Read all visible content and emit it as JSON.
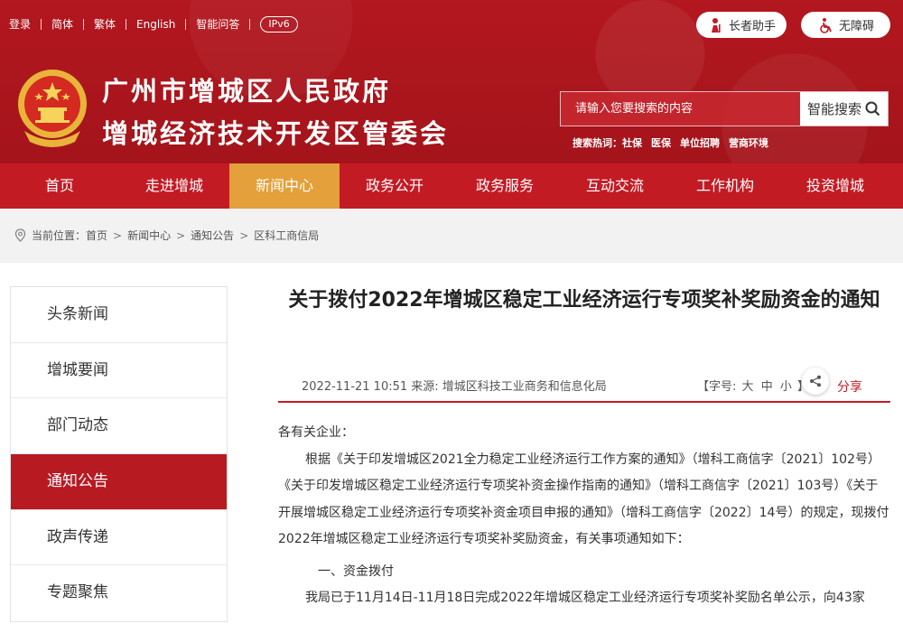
{
  "topbar": {
    "links": [
      "登录",
      "简体",
      "繁体",
      "English",
      "智能问答"
    ],
    "ipv6": "IPv6"
  },
  "assist": {
    "elder": "长者助手",
    "access": "无障碍"
  },
  "site": {
    "title_line1": "广州市增城区人民政府",
    "title_line2": "增城经济技术开发区管委会"
  },
  "search": {
    "placeholder": "请输入您要搜索的内容",
    "button": "智能搜索",
    "hot_label": "搜索热词：",
    "hot_words": [
      "社保",
      "医保",
      "单位招聘",
      "营商环境"
    ]
  },
  "nav": {
    "items": [
      "首页",
      "走进增城",
      "新闻中心",
      "政务公开",
      "政务服务",
      "互动交流",
      "工作机构",
      "投资增城"
    ],
    "active_index": 2
  },
  "breadcrumb": {
    "label": "当前位置：",
    "items": [
      "首页",
      "新闻中心",
      "通知公告",
      "区科工商信局"
    ]
  },
  "sidebar": {
    "items": [
      "头条新闻",
      "增城要闻",
      "部门动态",
      "通知公告",
      "政声传递",
      "专题聚焦"
    ],
    "active_index": 3
  },
  "article": {
    "title": "关于拨付2022年增城区稳定工业经济运行专项奖补奖励资金的通知",
    "date": "2022-11-21 10:51",
    "source": "来源: 增城区科技工业商务和信息化局",
    "fontsize_label": "【字号:",
    "fontsize_options": [
      "大",
      "中",
      "小"
    ],
    "fontsize_end": "】",
    "share": "分享",
    "greeting": "各有关企业：",
    "para1": "根据《关于印发增城区2021全力稳定工业经济运行工作方案的通知》（增科工商信字〔2021〕102号）《关于印发增城区稳定工业经济运行专项奖补资金操作指南的通知》（增科工商信字〔2021〕103号）《关于开展增城区稳定工业经济运行专项奖补资金项目申报的通知》（增科工商信字〔2022〕14号）的规定，现拨付2022年增城区稳定工业经济运行专项奖补奖励资金，有关事项通知如下：",
    "section1": "一、资金拨付",
    "para2": "我局已于11月14日-11月18日完成2022年增城区稳定工业经济运行专项奖补奖励名单公示，向43家"
  }
}
